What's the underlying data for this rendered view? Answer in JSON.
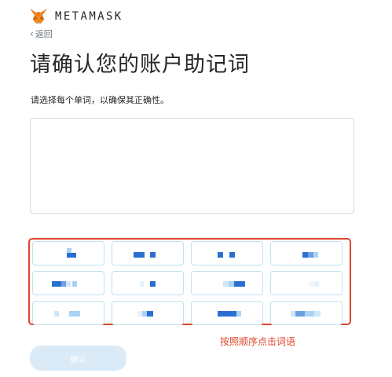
{
  "header": {
    "brand": "METAMASK",
    "logo_icon": "metamask-fox-icon"
  },
  "nav": {
    "back_label": "返回",
    "back_icon": "chevron-left-icon"
  },
  "page": {
    "title": "请确认您的账户助记词",
    "subtitle": "请选择每个单词，以确保其正确性。"
  },
  "word_grid": {
    "note": "seed words are pixelated / obscured in the screenshot",
    "count": 12
  },
  "annotation": {
    "hint": "按照顺序点击词语",
    "color": "#e0442a"
  },
  "actions": {
    "confirm_label": "确认",
    "confirm_disabled": true
  },
  "colors": {
    "accent": "#037dd6",
    "pixel_dark": "#2a6fd0",
    "pixel_light": "#a9d3f5",
    "confirm_bg": "#dbeaf7"
  }
}
